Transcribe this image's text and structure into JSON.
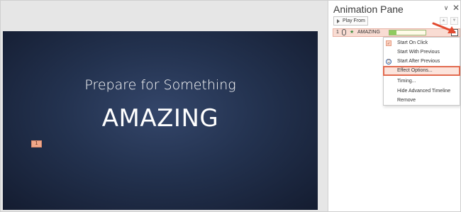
{
  "slide": {
    "subtitle": "Prepare for Something",
    "title": "AMAZING",
    "animation_tag": "1"
  },
  "pane": {
    "title": "Animation Pane",
    "play_button_label": "Play From",
    "move_up_glyph": "▲",
    "move_down_glyph": "▼",
    "collapse_glyph": "∨",
    "close_glyph": "✕"
  },
  "animation_item": {
    "number": "1",
    "label": "AMAZING",
    "dropdown_glyph": "▾",
    "effect_icon": "★"
  },
  "context_menu": {
    "items": [
      {
        "label": "Start On Click",
        "icon": "mouse-click-icon"
      },
      {
        "label": "Start With Previous",
        "icon": ""
      },
      {
        "label": "Start After Previous",
        "icon": "clock-icon"
      },
      {
        "label": "Effect Options...",
        "icon": ""
      },
      {
        "label": "Timing...",
        "icon": ""
      },
      {
        "label": "Hide Advanced Timeline",
        "icon": ""
      },
      {
        "label": "Remove",
        "icon": ""
      }
    ],
    "highlighted": "Effect Options..."
  },
  "colors": {
    "accent_red": "#e24a2f",
    "slide_bg": "#23324f",
    "timeline_fill": "#8fcb5f",
    "item_highlight": "#f9dcd3"
  }
}
